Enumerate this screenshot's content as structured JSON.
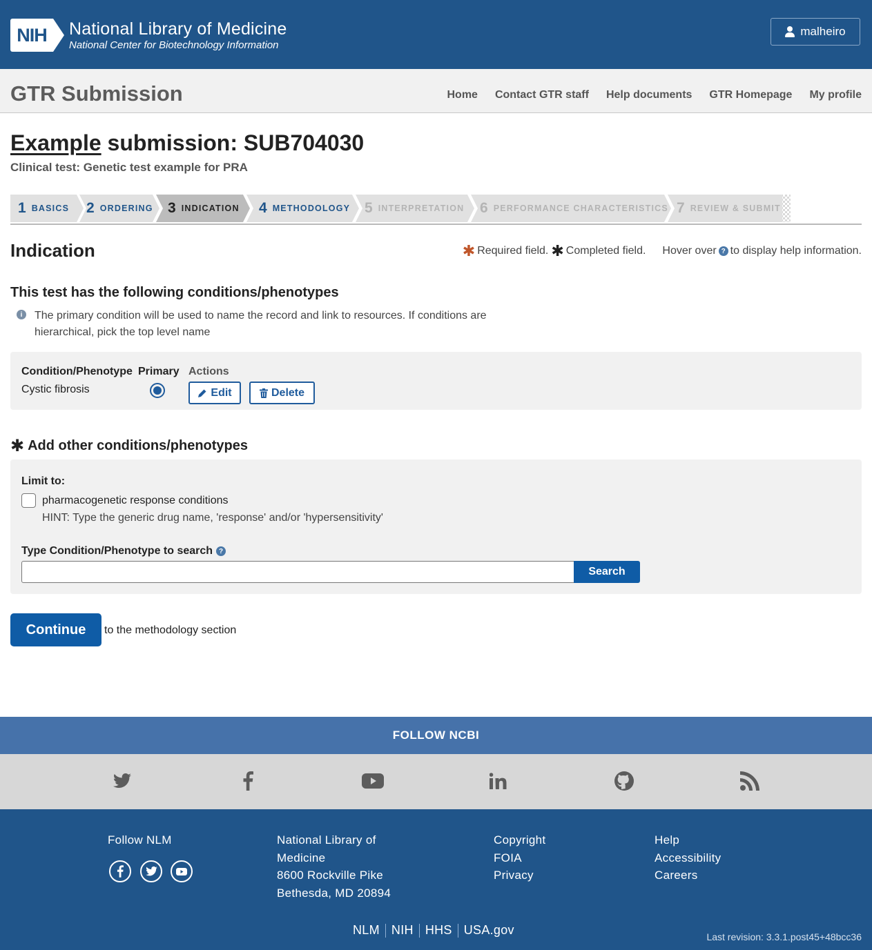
{
  "nih": {
    "logo_text": "NIH",
    "title": "National Library of Medicine",
    "subtitle": "National Center for Biotechnology Information",
    "username": "malheiro"
  },
  "app": {
    "title": "GTR Submission",
    "nav": [
      "Home",
      "Contact GTR staff",
      "Help documents",
      "GTR Homepage",
      "My profile"
    ]
  },
  "submission": {
    "title_prefix": "Example",
    "title_rest": " submission: SUB704030",
    "test_line": "Clinical test: Genetic test example for PRA"
  },
  "steps": [
    {
      "num": "1",
      "label": "BASICS",
      "state": "done"
    },
    {
      "num": "2",
      "label": "ORDERING",
      "state": "done"
    },
    {
      "num": "3",
      "label": "INDICATION",
      "state": "active"
    },
    {
      "num": "4",
      "label": "METHODOLOGY",
      "state": "done"
    },
    {
      "num": "5",
      "label": "INTERPRETATION",
      "state": "future"
    },
    {
      "num": "6",
      "label": "PERFORMANCE CHARACTERISTICS",
      "state": "future"
    },
    {
      "num": "7",
      "label": "REVIEW & SUBMIT",
      "state": "future"
    }
  ],
  "section": {
    "heading": "Indication",
    "legend_required": "Required field.",
    "legend_completed": "Completed field.",
    "legend_hover_pre": "Hover over",
    "legend_hover_post": "to display help information."
  },
  "conditions": {
    "heading": "This test has the following conditions/phenotypes",
    "info": "The primary condition will be used to name the record and link to resources. If conditions are hierarchical, pick the top level name",
    "col_condition": "Condition/Phenotype",
    "col_primary": "Primary",
    "col_actions": "Actions",
    "rows": [
      {
        "name": "Cystic fibrosis",
        "primary": true
      }
    ],
    "edit_label": "Edit",
    "delete_label": "Delete"
  },
  "add": {
    "heading": "Add other conditions/phenotypes",
    "limit_label": "Limit to:",
    "checkbox_label": "pharmacogenetic response conditions",
    "hint": "HINT: Type the generic drug name, 'response' and/or 'hypersensitivity'",
    "search_label": "Type Condition/Phenotype to search",
    "search_value": "",
    "search_button": "Search"
  },
  "continue": {
    "button": "Continue",
    "text": "to the methodology section"
  },
  "footer": {
    "follow_ncbi": "FOLLOW NCBI",
    "social_icons": [
      "twitter-icon",
      "facebook-icon",
      "youtube-icon",
      "linkedin-icon",
      "github-icon",
      "rss-icon"
    ],
    "follow_nlm": "Follow NLM",
    "nlm_address": [
      "National Library of",
      "Medicine",
      "8600 Rockville Pike",
      "Bethesda, MD 20894"
    ],
    "links_col1": [
      "Copyright",
      "FOIA",
      "Privacy"
    ],
    "links_col2": [
      "Help",
      "Accessibility",
      "Careers"
    ],
    "bottom_links": [
      "NLM",
      "NIH",
      "HHS",
      "USA.gov"
    ],
    "revision": "Last revision: 3.3.1.post45+48bcc36"
  },
  "colors": {
    "header_blue": "#20558a",
    "button_blue": "#0f5ca6",
    "follow_bar": "#4672aa",
    "required_star": "#c0562a"
  }
}
